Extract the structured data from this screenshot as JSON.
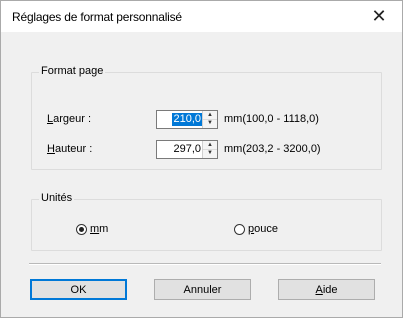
{
  "window": {
    "title": "Réglages de format personnalisé",
    "close_glyph": "✕"
  },
  "format_page": {
    "label": "Format page",
    "width": {
      "label_mnemonic": "L",
      "label_rest": "argeur :",
      "value": "210,0",
      "range": "mm(100,0 - 1118,0)"
    },
    "height": {
      "label_mnemonic": "H",
      "label_rest": "auteur :",
      "value": "297,0",
      "range": "mm(203,2 - 3200,0)"
    }
  },
  "units": {
    "label": "Unités",
    "options": [
      {
        "mnemonic": "m",
        "rest": "m",
        "checked": true
      },
      {
        "mnemonic": "p",
        "rest": "ouce",
        "checked": false
      }
    ]
  },
  "buttons": {
    "ok": "OK",
    "cancel": "Annuler",
    "help_mnemonic": "A",
    "help_rest": "ide"
  },
  "colors": {
    "accent": "#0078d7"
  },
  "icons": {
    "close": "close-icon",
    "spin_up": "spin-up-icon",
    "spin_down": "spin-down-icon"
  }
}
